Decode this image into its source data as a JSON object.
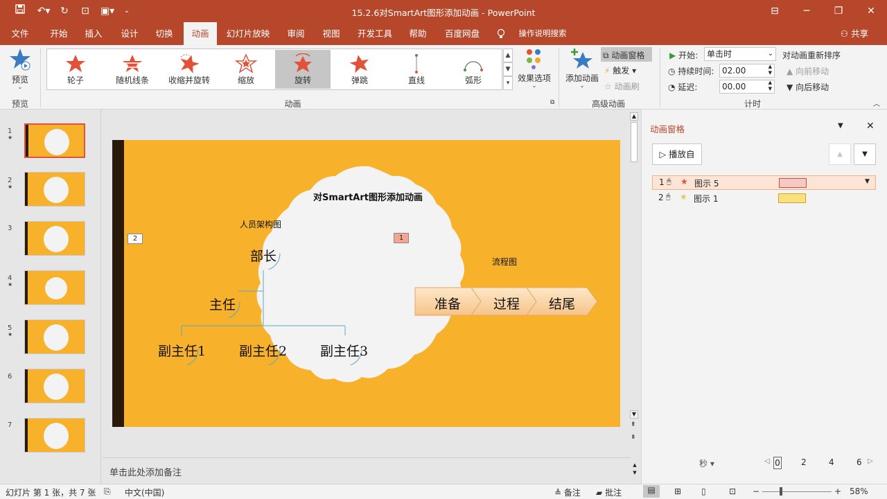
{
  "window": {
    "title": "15.2.6对SmartArt图形添加动画 - PowerPoint"
  },
  "tabs": [
    "文件",
    "开始",
    "插入",
    "设计",
    "切换",
    "动画",
    "幻灯片放映",
    "审阅",
    "视图",
    "开发工具",
    "帮助",
    "百度网盘"
  ],
  "active_tab": "动画",
  "tell_me": "操作说明搜索",
  "share": "共享",
  "ribbon": {
    "preview": {
      "label": "预览",
      "group": "预览"
    },
    "animations": [
      "轮子",
      "随机线条",
      "收缩并旋转",
      "缩放",
      "旋转",
      "弹跳",
      "直线",
      "弧形"
    ],
    "selected_animation": "旋转",
    "effect_options": "效果选项",
    "animation_group": "动画",
    "add_animation": "添加动画",
    "animation_pane": "动画窗格",
    "trigger": "触发",
    "animation_painter": "动画刷",
    "advanced_group": "高级动画",
    "start_label": "开始:",
    "start_value": "单击时",
    "duration_label": "持续时间:",
    "duration_value": "02.00",
    "delay_label": "延迟:",
    "delay_value": "00.00",
    "reorder_title": "对动画重新排序",
    "move_earlier": "向前移动",
    "move_later": "向后移动",
    "timing_group": "计时"
  },
  "slides": [
    "1",
    "2",
    "3",
    "4",
    "5",
    "6",
    "7"
  ],
  "slide": {
    "title": "对SmartArt图形添加动画",
    "org_title": "人员架构图",
    "org_top": "部长",
    "org_mid": "主任",
    "org_subs": [
      "副主任1",
      "副主任2",
      "副主任3"
    ],
    "flow_title": "流程图",
    "flow_steps": [
      "准备",
      "过程",
      "结尾"
    ],
    "tag1": "1",
    "tag2": "2"
  },
  "notes_placeholder": "单击此处添加备注",
  "anim_pane": {
    "title": "动画窗格",
    "play_from": "播放自",
    "items": [
      {
        "num": "1",
        "name": "图示 5",
        "color": "#f8c9c3"
      },
      {
        "num": "2",
        "name": "图示 1",
        "color": "#fbe07c"
      }
    ],
    "seconds_label": "秒",
    "timeline": [
      "0",
      "2",
      "4",
      "6"
    ]
  },
  "status": {
    "slide_info": "幻灯片 第 1 张，共 7 张",
    "language": "中文(中国)",
    "notes": "备注",
    "comments": "批注",
    "zoom": "58%"
  },
  "colors": {
    "accent": "#b7472a",
    "slide_bg": "#f7b12a",
    "star_red": "#e0533a"
  }
}
